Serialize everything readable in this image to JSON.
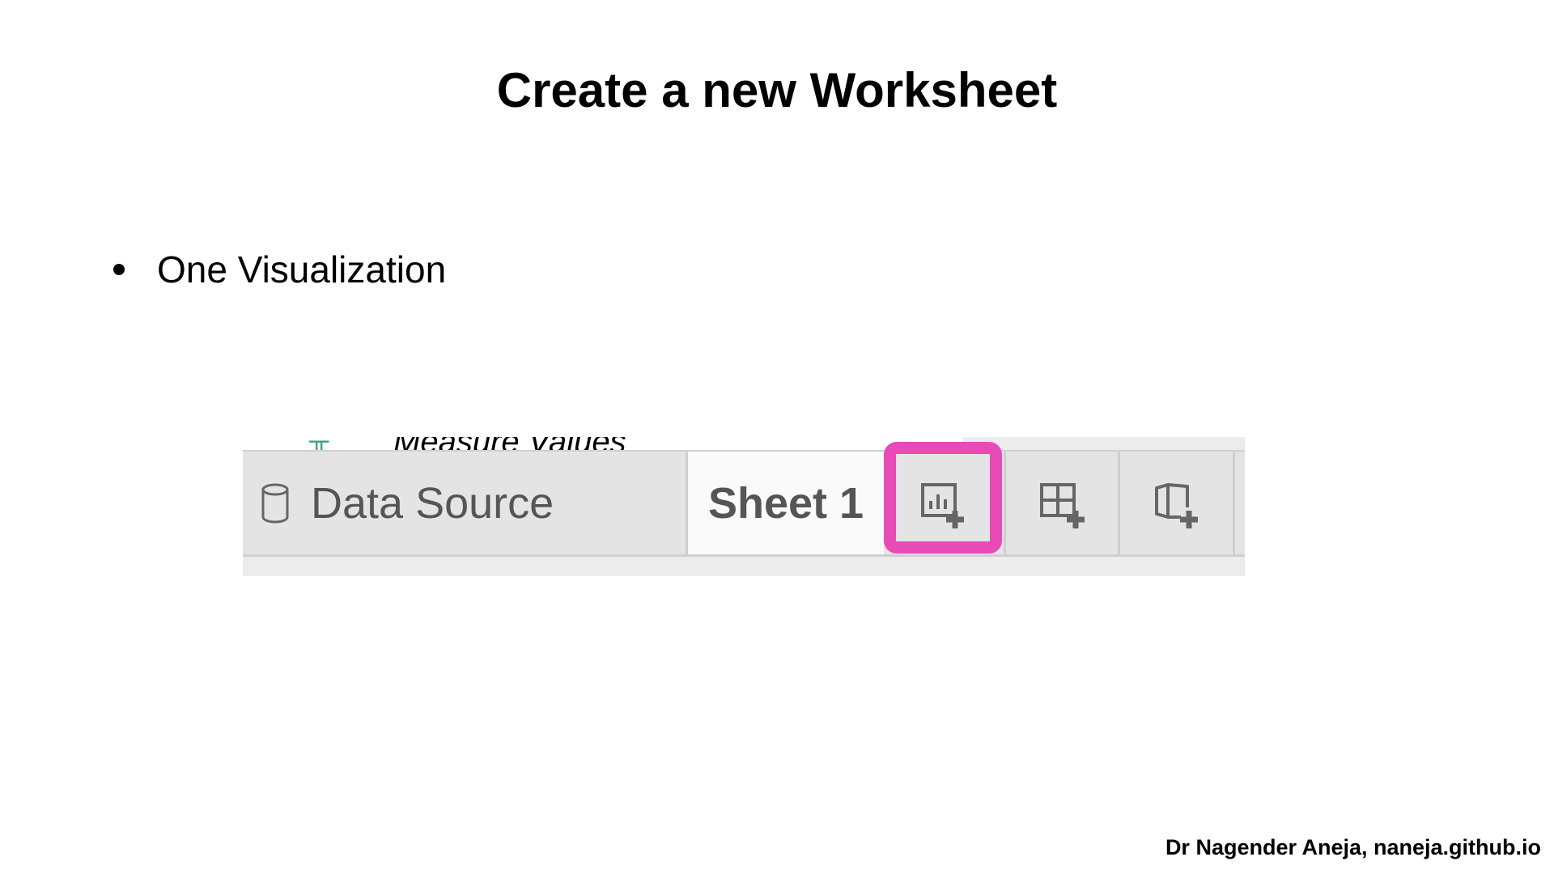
{
  "slide": {
    "title": "Create a new Worksheet",
    "bullets": [
      "One Visualization"
    ],
    "credit": "Dr Nagender Aneja, naneja.github.io"
  },
  "tableau_tabbar": {
    "clipped_field": "Measure Values",
    "data_source_tab": "Data Source",
    "sheet_tab": "Sheet 1",
    "icons": {
      "data_source": "database-icon",
      "new_sheet": "new-worksheet-icon",
      "new_dashboard": "new-dashboard-icon",
      "new_story": "new-story-icon"
    },
    "highlight_color": "#e84bb6"
  }
}
